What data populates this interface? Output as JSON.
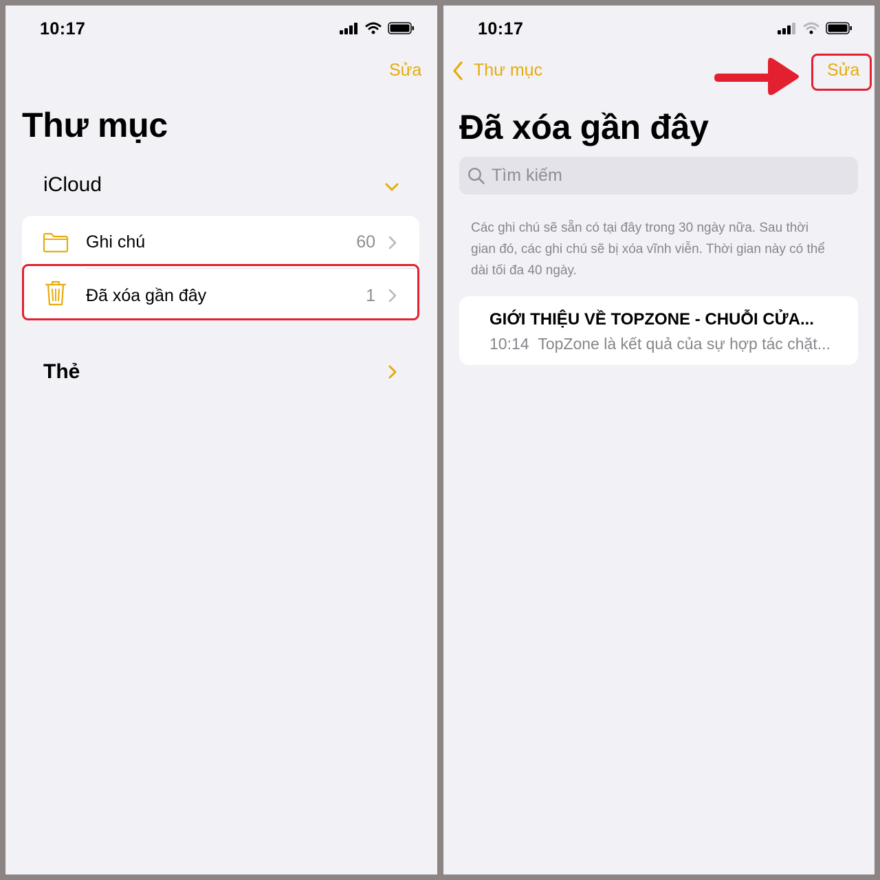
{
  "left": {
    "status": {
      "time": "10:17"
    },
    "nav": {
      "edit_label": "Sửa"
    },
    "title": "Thư mục",
    "icloud": {
      "header": "iCloud",
      "folders": [
        {
          "label": "Ghi chú",
          "count": "60",
          "icon": "folder-icon"
        },
        {
          "label": "Đã xóa gần đây",
          "count": "1",
          "icon": "trash-icon"
        }
      ]
    },
    "tags": {
      "header": "Thẻ"
    }
  },
  "right": {
    "status": {
      "time": "10:17"
    },
    "nav": {
      "back_label": "Thư mục",
      "edit_label": "Sửa"
    },
    "title": "Đã xóa gần đây",
    "search": {
      "placeholder": "Tìm kiếm"
    },
    "info_text": "Các ghi chú sẽ sẵn có tại đây trong 30 ngày nữa. Sau thời gian đó, các ghi chú sẽ bị xóa vĩnh viễn. Thời gian này có thể dài tối đa 40 ngày.",
    "notes": [
      {
        "title": "GIỚI THIỆU VỀ TOPZONE - CHUỖI CỬA...",
        "time": "10:14",
        "preview": "TopZone là kết quả của sự hợp tác chặt..."
      }
    ]
  },
  "colors": {
    "accent": "#e6ac0b",
    "highlight": "#e2202f",
    "background": "#f2f1f6"
  }
}
